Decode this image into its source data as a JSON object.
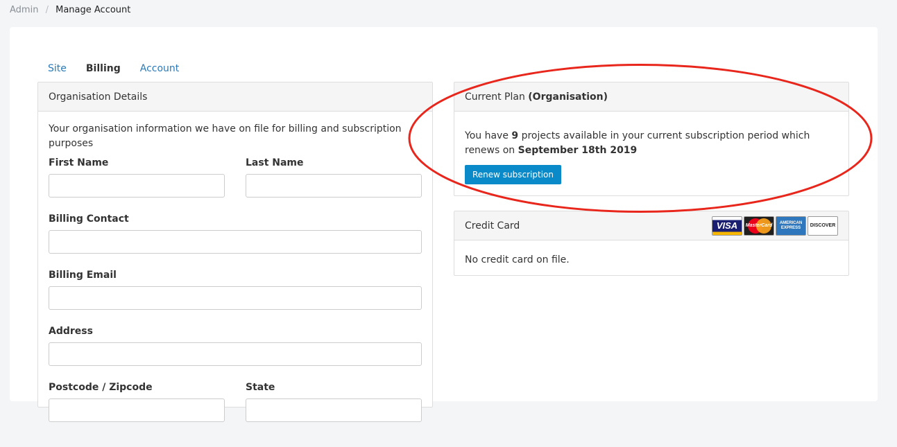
{
  "breadcrumb": {
    "parent": "Admin",
    "separator": "/",
    "current": "Manage Account"
  },
  "tabs": [
    {
      "label": "Site",
      "active": false
    },
    {
      "label": "Billing",
      "active": true
    },
    {
      "label": "Account",
      "active": false
    }
  ],
  "org_details": {
    "title": "Organisation Details",
    "intro": "Your organisation information we have on file for billing and subscription purposes",
    "fields": {
      "first_name": {
        "label": "First Name",
        "value": ""
      },
      "last_name": {
        "label": "Last Name",
        "value": ""
      },
      "billing_contact": {
        "label": "Billing Contact",
        "value": ""
      },
      "billing_email": {
        "label": "Billing Email",
        "value": ""
      },
      "address": {
        "label": "Address",
        "value": ""
      },
      "postcode": {
        "label": "Postcode / Zipcode",
        "value": ""
      },
      "state": {
        "label": "State",
        "value": ""
      }
    }
  },
  "current_plan": {
    "title": "Current Plan",
    "plan_name": "(Organisation)",
    "text_before": "You have ",
    "projects_count": "9",
    "text_after": " projects available in your current subscription period which renews on ",
    "renew_date": "September 18th 2019",
    "renew_button": "Renew subscription"
  },
  "credit_card": {
    "title": "Credit Card",
    "status": "No credit card on file.",
    "logos": {
      "visa": "VISA",
      "mastercard": "MasterCard",
      "amex_top": "AMERICAN",
      "amex_bottom": "EXPRESS",
      "discover": "DISCOVER"
    }
  },
  "colors": {
    "accent": "#0b8ac9",
    "link": "#2a7ab8",
    "annotation": "#e8261c"
  }
}
